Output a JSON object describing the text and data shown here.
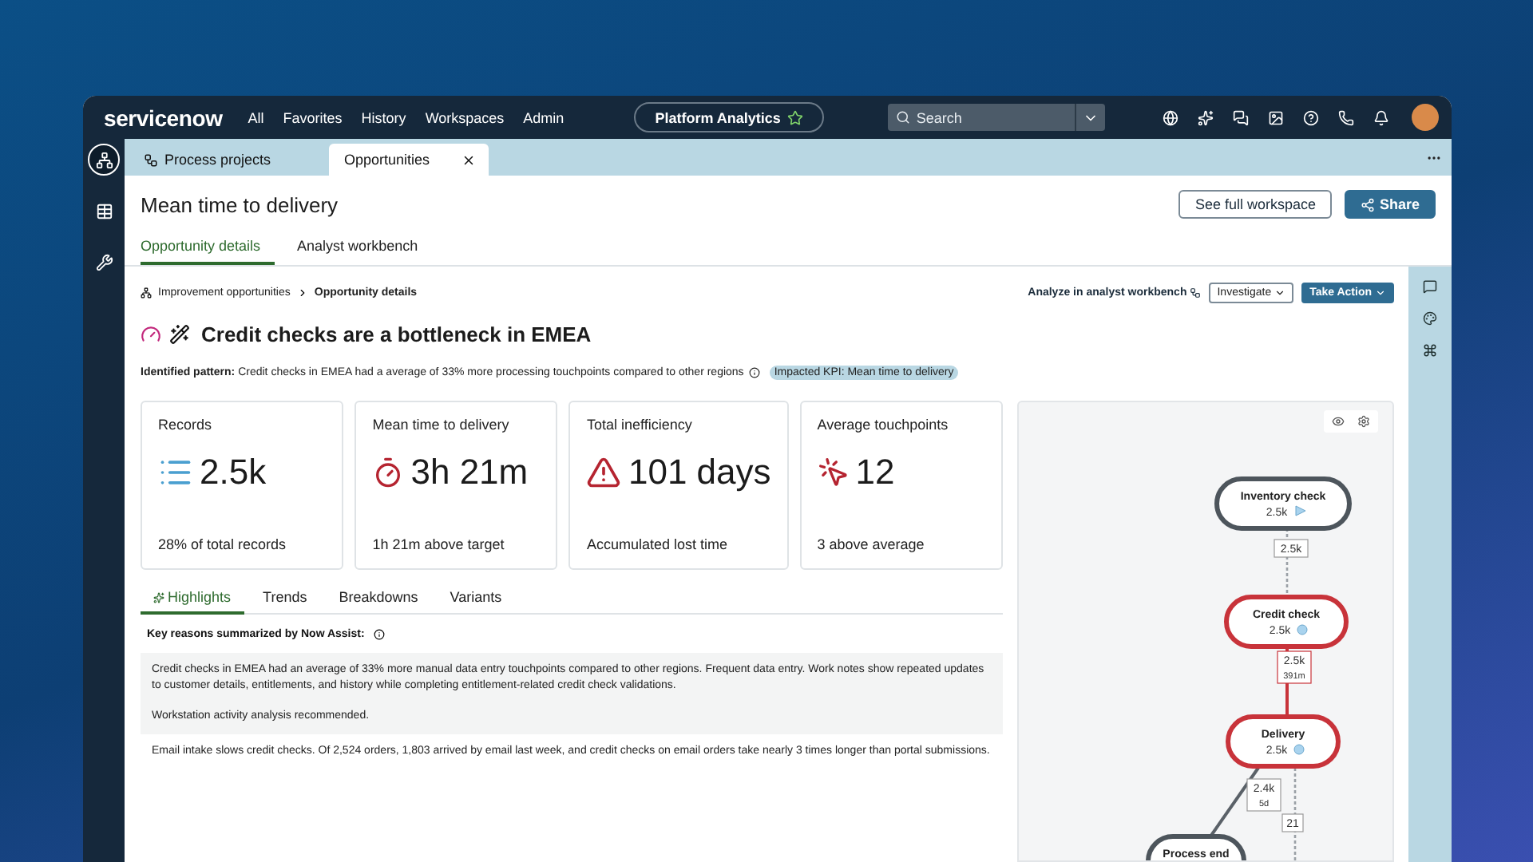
{
  "nav": {
    "logo": "servicenow",
    "links": [
      "All",
      "Favorites",
      "History",
      "Workspaces",
      "Admin"
    ],
    "workspace": "Platform Analytics",
    "workspace_starred": true,
    "search": {
      "placeholder": "Search"
    }
  },
  "rail": [
    {
      "kind": "tree",
      "selected": true
    },
    {
      "kind": "table",
      "selected": false
    },
    {
      "kind": "wrench",
      "selected": false
    }
  ],
  "tabs": [
    {
      "label": "Process projects",
      "selected": false
    },
    {
      "label": "Opportunities",
      "selected": true
    }
  ],
  "page": {
    "title": "Mean time to delivery",
    "buttons": [
      {
        "label": "See full workspace",
        "kind": "outline"
      },
      {
        "label": "Share",
        "kind": "primary"
      }
    ]
  },
  "subtabs": [
    {
      "label": "Opportunity details",
      "selected": true
    },
    {
      "label": "Analyst workbench",
      "selected": false
    }
  ],
  "breadcrumb": [
    "Improvement opportunities",
    "Opportunity details"
  ],
  "actions": [
    {
      "label": "Analyze in analyst workbench",
      "kind": "link"
    },
    {
      "label": "Investigate",
      "kind": "outline"
    },
    {
      "label": "Take Action",
      "kind": "primary"
    }
  ],
  "opportunity": {
    "title": "Credit checks are a bottleneck in EMEA",
    "pattern_label": "Identified pattern:",
    "pattern": "Credit checks in EMEA had a average of 33% more processing touchpoints compared to other regions",
    "kpi_tag": "Impacted KPI: Mean time to delivery"
  },
  "metrics": [
    {
      "label": "Records",
      "value": "2.5k",
      "note": "28% of total records",
      "kind": "list"
    },
    {
      "label": "Mean time to delivery",
      "value": "3h 21m",
      "note": "1h 21m above target",
      "kind": "timer"
    },
    {
      "label": "Total inefficiency",
      "value": "101 days",
      "note": "Accumulated lost time",
      "kind": "warning"
    },
    {
      "label": "Average touchpoints",
      "value": "12",
      "note": "3 above average",
      "kind": "click"
    }
  ],
  "detail_tabs": [
    {
      "label": "Highlights",
      "selected": true
    },
    {
      "label": "Trends",
      "selected": false
    },
    {
      "label": "Breakdowns",
      "selected": false
    },
    {
      "label": "Variants",
      "selected": false
    }
  ],
  "summary": {
    "heading": "Key reasons summarized by Now Assist:",
    "highlighted_paragraphs": [
      "Credit checks in EMEA had an average of 33% more manual data entry touchpoints compared to other regions. Frequent data entry. Work notes show repeated updates to customer details, entitlements, and history while completing entitlement-related credit check validations.",
      "Workstation activity analysis recommended."
    ],
    "paragraphs": [
      "Email intake slows credit checks. Of 2,524 orders, 1,803 arrived by email last week, and credit checks on email orders take nearly 3 times longer than portal submissions."
    ]
  },
  "process_map": {
    "nodes": [
      {
        "name": "Inventory check",
        "count": "2.5k",
        "highlighted": false,
        "kind": "start"
      },
      {
        "name": "Credit check",
        "count": "2.5k",
        "highlighted": true,
        "kind": "activity"
      },
      {
        "name": "Delivery",
        "count": "2.5k",
        "highlighted": true,
        "kind": "activity"
      },
      {
        "name": "Process end",
        "highlighted": false,
        "kind": "end"
      }
    ],
    "edges": [
      {
        "labels": [
          "2.5k"
        ],
        "highlighted": false
      },
      {
        "labels": [
          "2.5k",
          "391m"
        ],
        "highlighted": true
      },
      {
        "labels": [
          "2.4k",
          "5d"
        ],
        "highlighted": false
      },
      {
        "labels": [
          "21"
        ],
        "highlighted": false
      }
    ]
  }
}
